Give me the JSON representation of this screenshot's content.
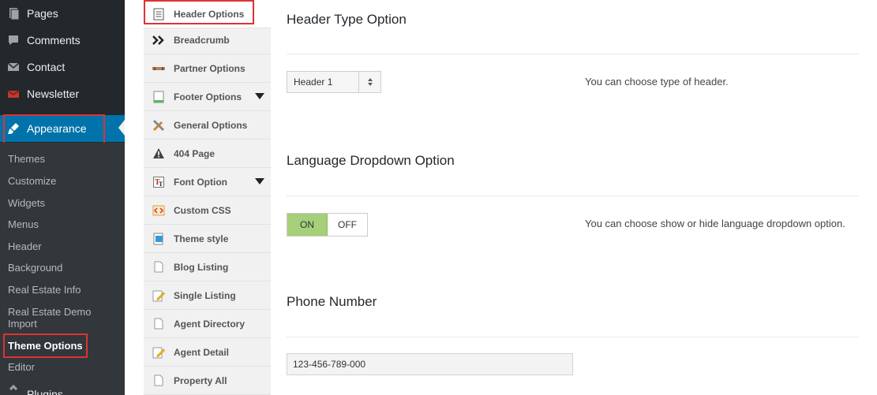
{
  "admin_menu": {
    "items": [
      {
        "label": "Pages",
        "icon": "pages-icon"
      },
      {
        "label": "Comments",
        "icon": "comments-icon"
      },
      {
        "label": "Contact",
        "icon": "mail-icon"
      },
      {
        "label": "Newsletter",
        "icon": "newsletter-icon"
      },
      {
        "label": "Appearance",
        "icon": "paintbrush-icon",
        "active": true
      }
    ],
    "submenu": [
      "Themes",
      "Customize",
      "Widgets",
      "Menus",
      "Header",
      "Background",
      "Real Estate Info",
      "Real Estate Demo Import",
      "Theme Options",
      "Editor"
    ],
    "current_submenu": "Theme Options",
    "partial_next": "Plugins",
    "accent": "#0073aa",
    "highlight": "#dd3333"
  },
  "theme_tabs": [
    {
      "label": "Header Options",
      "icon": "document-icon",
      "active": true
    },
    {
      "label": "Breadcrumb",
      "icon": "double-chevron-icon"
    },
    {
      "label": "Partner Options",
      "icon": "partner-icon"
    },
    {
      "label": "Footer Options",
      "icon": "footer-page-icon",
      "expandable": true
    },
    {
      "label": "General Options",
      "icon": "tools-icon"
    },
    {
      "label": "404 Page",
      "icon": "warning-icon"
    },
    {
      "label": "Font Option",
      "icon": "font-icon",
      "expandable": true
    },
    {
      "label": "Custom CSS",
      "icon": "code-icon"
    },
    {
      "label": "Theme style",
      "icon": "theme-style-icon"
    },
    {
      "label": "Blog Listing",
      "icon": "blank-page-icon"
    },
    {
      "label": "Single Listing",
      "icon": "edit-page-icon"
    },
    {
      "label": "Agent Directory",
      "icon": "blank-page-icon"
    },
    {
      "label": "Agent Detail",
      "icon": "edit-page-icon"
    },
    {
      "label": "Property All",
      "icon": "blank-page-icon"
    }
  ],
  "options": {
    "header_type": {
      "title": "Header Type Option",
      "value": "Header 1",
      "description": "You can choose type of header."
    },
    "language_dropdown": {
      "title": "Language Dropdown Option",
      "on_label": "ON",
      "off_label": "OFF",
      "state": "ON",
      "description": "You can choose show or hide language dropdown option."
    },
    "phone": {
      "title": "Phone Number",
      "value": "123-456-789-000"
    }
  }
}
